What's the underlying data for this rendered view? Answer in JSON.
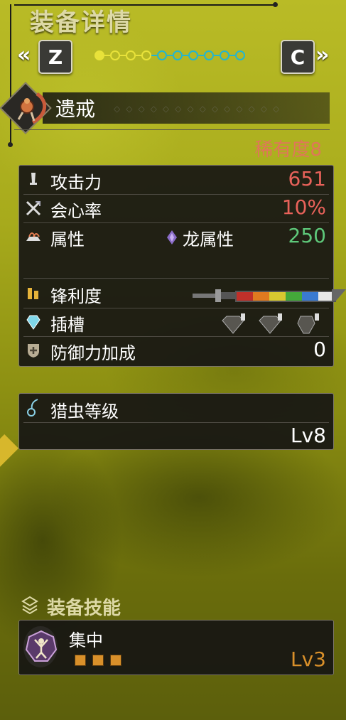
{
  "header": {
    "title": "装备详情",
    "nav_left_key": "Z",
    "nav_right_key": "C",
    "nav_left_chevron": "«",
    "nav_right_chevron": "»",
    "page_dots": {
      "total": 10,
      "active": 0,
      "yellow_count": 4,
      "yellow_color": "#e8e23a",
      "cyan_color": "#23b5d0"
    }
  },
  "weapon": {
    "name": "遗戒",
    "rarity": "稀有度8",
    "icon": "insect-glaive-icon"
  },
  "stats": {
    "attack_label": "攻击力",
    "attack_value": "651",
    "affinity_label": "会心率",
    "affinity_value": "10%",
    "element_label": "属性",
    "element_name": "龙属性",
    "element_value": "250",
    "sharpness_label": "锋利度",
    "sharpness_colors": [
      "#c0302a",
      "#e07a20",
      "#d8c830",
      "#44a83a",
      "#3a7ad0",
      "#e8e8e8"
    ],
    "slots_label": "插槽",
    "defense_label": "防御力加成",
    "defense_value": "0"
  },
  "kinsect": {
    "label": "猎虫等级",
    "level": "Lv8"
  },
  "skills": {
    "section_title": "装备技能",
    "items": [
      {
        "name": "集中",
        "level": "Lv3",
        "pips": 3
      }
    ]
  },
  "colors": {
    "attack": "#e8625a",
    "element_value": "#5ec87a",
    "rarity": "#e0765a",
    "skill_level": "#d9902a"
  }
}
